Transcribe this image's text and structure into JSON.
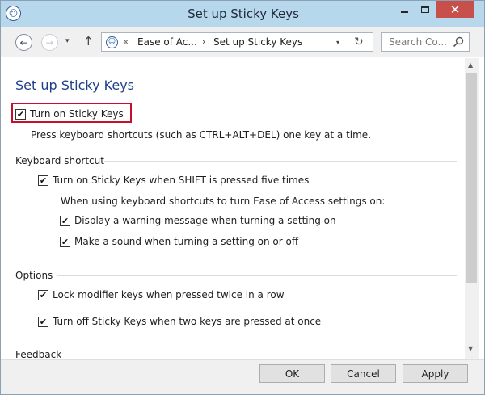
{
  "window": {
    "title": "Set up Sticky Keys",
    "icon": "ease-of-access-icon",
    "controls": {
      "minimize": "minimize",
      "maximize": "maximize",
      "close": "✕"
    }
  },
  "navigation": {
    "back": "←",
    "forward": "→",
    "recent": "▾",
    "up": "↑",
    "breadcrumb_sep_1": "«",
    "breadcrumb": [
      "Ease of Ac...",
      "Set up Sticky Keys"
    ],
    "breadcrumb_sep_2": "›",
    "dropdown": "▾",
    "refresh": "↻"
  },
  "search": {
    "placeholder": "Search Co..."
  },
  "page": {
    "title": "Set up Sticky Keys",
    "turn_on": {
      "label": "Turn on Sticky Keys",
      "checked": true
    },
    "description": "Press keyboard shortcuts (such as CTRL+ALT+DEL) one key at a time."
  },
  "keyboard_shortcut": {
    "heading": "Keyboard shortcut",
    "shift_five": {
      "label": "Turn on Sticky Keys when SHIFT is pressed five times",
      "checked": true
    },
    "note": "When using keyboard shortcuts to turn Ease of Access settings on:",
    "warning": {
      "label": "Display a warning message when turning a setting on",
      "checked": true
    },
    "sound": {
      "label": "Make a sound when turning a setting on or off",
      "checked": true
    }
  },
  "options": {
    "heading": "Options",
    "lock_modifier": {
      "label": "Lock modifier keys when pressed twice in a row",
      "checked": true
    },
    "turn_off_two": {
      "label": "Turn off Sticky Keys when two keys are pressed at once",
      "checked": true
    }
  },
  "checkmark": "✔",
  "partial_heading": "Feedback",
  "scrollbar": {
    "up": "▲",
    "down": "▼"
  },
  "buttons": {
    "ok": "OK",
    "cancel": "Cancel",
    "apply": "Apply"
  },
  "colors": {
    "title_bar": "#b7d7ec",
    "close_button": "#c7504a",
    "heading_blue": "#1e3f8a",
    "highlight_red": "#c8102e"
  }
}
